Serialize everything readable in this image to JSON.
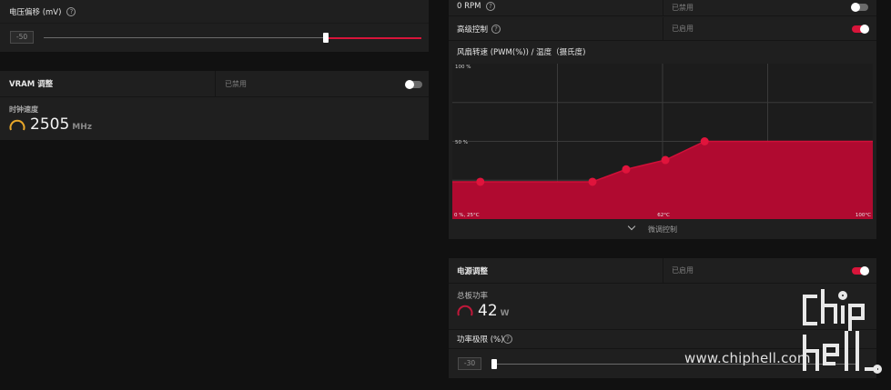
{
  "voltage": {
    "label": "电压偏移 (mV)",
    "value": "-50",
    "slider_fraction": 0.75
  },
  "vram": {
    "title": "VRAM 调整",
    "status": "已禁用",
    "clock_label": "时钟速度",
    "clock_value": "2505",
    "clock_unit": "MHz"
  },
  "zero_rpm": {
    "label": "0 RPM",
    "status": "已禁用"
  },
  "advanced": {
    "label": "高级控制",
    "status": "已启用"
  },
  "fan_curve": {
    "title": "风扇转速 (PWM(%)) / 温度（摄氏度)",
    "fine_tune_label": "微调控制"
  },
  "chart_data": {
    "type": "area",
    "title": "风扇转速 (PWM(%)) / 温度（摄氏度)",
    "xlabel": "",
    "ylabel": "",
    "x_tick_labels": [
      "0 %, 25°C",
      "62°C",
      "100°C"
    ],
    "y_tick_labels": [
      "100 %",
      "50 %"
    ],
    "xlim": [
      25,
      100
    ],
    "ylim": [
      0,
      100
    ],
    "grid": true,
    "series": [
      {
        "x": [
          25,
          30,
          50,
          56,
          63,
          70,
          100
        ],
        "y": [
          24,
          24,
          24,
          32,
          38,
          50,
          50
        ]
      }
    ],
    "control_points": [
      {
        "x": 30,
        "y": 24
      },
      {
        "x": 50,
        "y": 24
      },
      {
        "x": 56,
        "y": 32
      },
      {
        "x": 63,
        "y": 38
      },
      {
        "x": 70,
        "y": 50
      }
    ],
    "fill_color": "#b00a30",
    "point_color": "#e0143c"
  },
  "power": {
    "title": "电源调整",
    "status": "已启用",
    "board_power_label": "总板功率",
    "board_power_value": "42",
    "board_power_unit": "W",
    "limit_label": "功率极限 (%)",
    "limit_value": "-30",
    "limit_slider_fraction": 0.0
  },
  "watermark": {
    "text": "www.chiphell.com",
    "logo_text": "chip hell"
  },
  "colors": {
    "accent": "#d8153a",
    "panel": "#1f1f1f",
    "background": "#111111",
    "gauge_vram": "#e8a72a",
    "gauge_power": "#c0183a"
  }
}
